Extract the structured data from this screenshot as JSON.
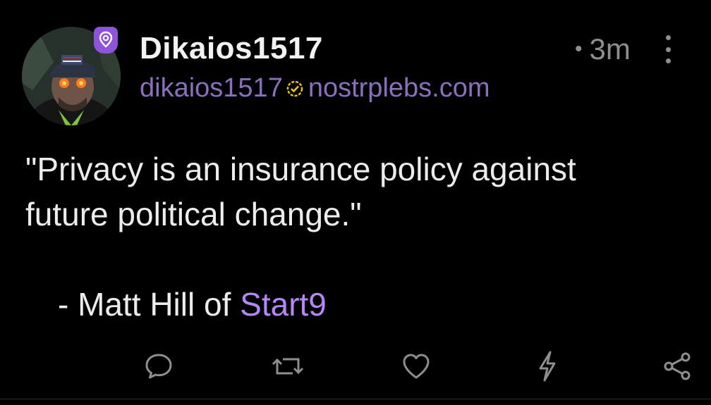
{
  "post": {
    "author_name": "Dikaios1517",
    "author_handle_user": "dikaios1517",
    "author_handle_domain": "nostrplebs.com",
    "time_ago": "3m",
    "content": {
      "line1": "\"Privacy is an insurance policy against",
      "line2": "future political change.\"",
      "attrib_prefix": "- Matt Hill of ",
      "attrib_link": "Start9"
    },
    "actions": [
      "reply-icon",
      "repost-icon",
      "like-icon",
      "zap-icon",
      "share-icon"
    ]
  },
  "colors": {
    "background": "#000000",
    "accent_purple": "#8e53d9",
    "handle": "#8a6fbd",
    "link": "#b586f5",
    "muted": "#8e8e8e"
  }
}
